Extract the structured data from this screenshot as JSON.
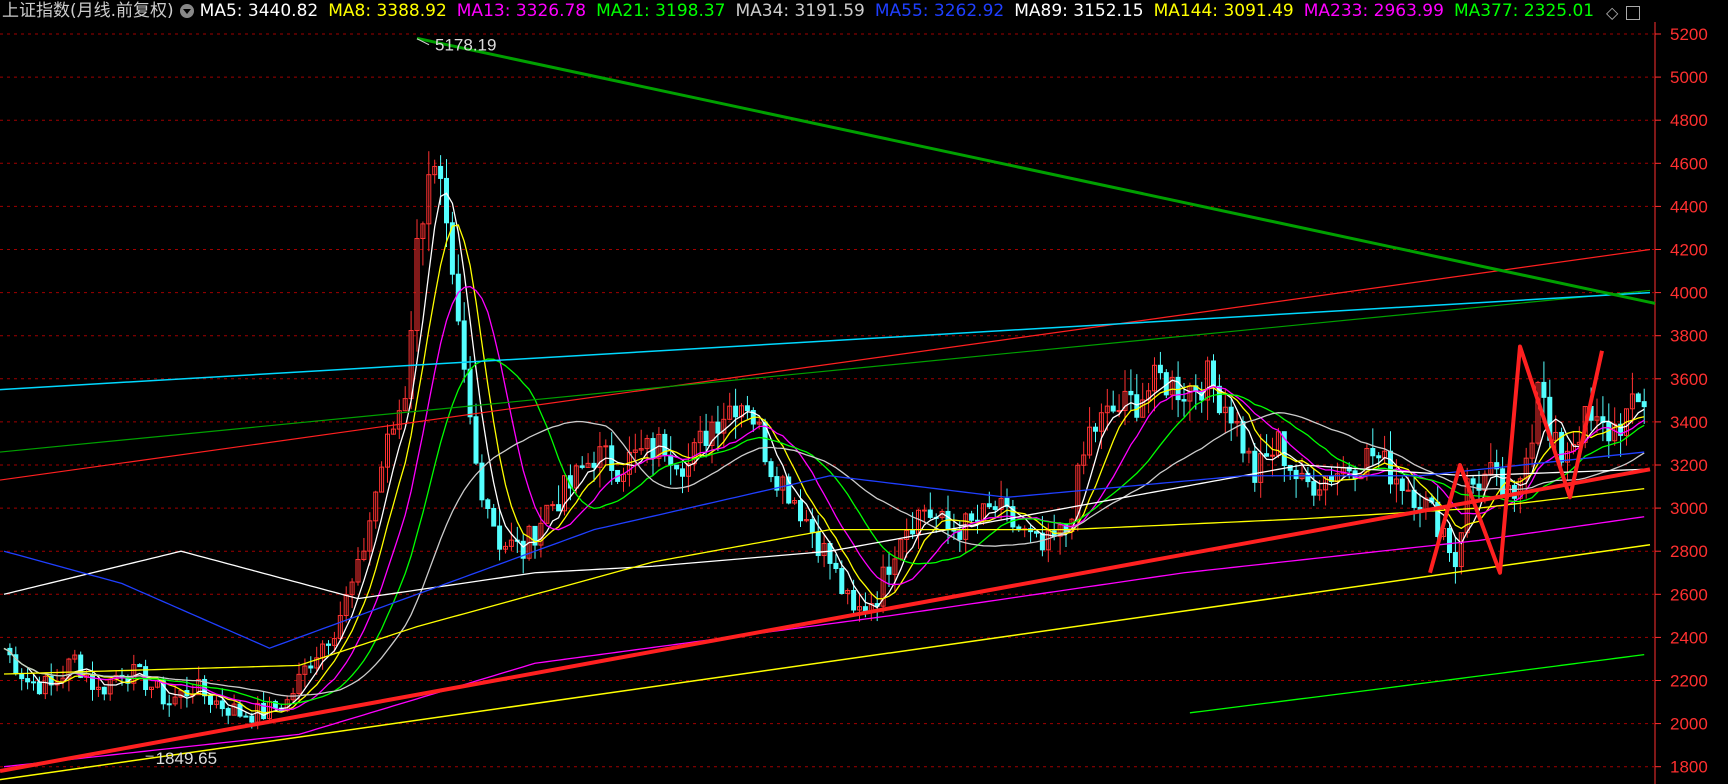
{
  "header": {
    "title": "上证指数(月线.前复权)",
    "ma": [
      {
        "label": "MA5: 3440.82",
        "color": "#ffffff"
      },
      {
        "label": "MA8: 3388.92",
        "color": "#ffff00"
      },
      {
        "label": "MA13: 3326.78",
        "color": "#ff00ff"
      },
      {
        "label": "MA21: 3198.37",
        "color": "#00ff00"
      },
      {
        "label": "MA34: 3191.59",
        "color": "#cccccc"
      },
      {
        "label": "MA55: 3262.92",
        "color": "#1f3fff"
      },
      {
        "label": "MA89: 3152.15",
        "color": "#ffffff"
      },
      {
        "label": "MA144: 3091.49",
        "color": "#ffff00"
      },
      {
        "label": "MA233: 2963.99",
        "color": "#ff00ff"
      },
      {
        "label": "MA377: 2325.01",
        "color": "#00ff00"
      }
    ]
  },
  "colors": {
    "up": "#ff3232",
    "down": "#54ffff",
    "grid": "#a00000",
    "axis": "#ff3030"
  },
  "chart_data": {
    "type": "candlestick",
    "title": "上证指数(月线.前复权)",
    "ylim": [
      1750,
      5300
    ],
    "yticks": [
      1800,
      2000,
      2200,
      2400,
      2600,
      2800,
      3000,
      3200,
      3400,
      3600,
      3800,
      4000,
      4200,
      4400,
      4600,
      4800,
      5000,
      5200
    ],
    "ytick_labels": [
      "1800",
      "2000",
      "2200",
      "2400",
      "2600",
      "2800",
      "3000",
      "3200",
      "3400",
      "3600",
      "3800",
      "4000",
      "4200",
      "4400",
      "4600",
      "4800",
      "5000",
      "5200"
    ],
    "annotations": {
      "high": "5178.19",
      "low": "1849.65"
    },
    "close_anchors": [
      [
        0,
        2350
      ],
      [
        4,
        2200
      ],
      [
        8,
        2170
      ],
      [
        12,
        2300
      ],
      [
        16,
        2150
      ],
      [
        20,
        2250
      ],
      [
        24,
        2200
      ],
      [
        28,
        2100
      ],
      [
        32,
        2170
      ],
      [
        36,
        2100
      ],
      [
        40,
        2050
      ],
      [
        44,
        2050
      ],
      [
        48,
        2100
      ],
      [
        52,
        2300
      ],
      [
        56,
        2450
      ],
      [
        60,
        2700
      ],
      [
        64,
        3200
      ],
      [
        68,
        3550
      ],
      [
        70,
        4200
      ],
      [
        72,
        4600
      ],
      [
        74,
        4450
      ],
      [
        76,
        4000
      ],
      [
        78,
        3600
      ],
      [
        80,
        3200
      ],
      [
        84,
        2850
      ],
      [
        88,
        2800
      ],
      [
        92,
        3000
      ],
      [
        96,
        3100
      ],
      [
        100,
        3250
      ],
      [
        104,
        3200
      ],
      [
        108,
        3250
      ],
      [
        112,
        3300
      ],
      [
        116,
        3200
      ],
      [
        120,
        3400
      ],
      [
        124,
        3500
      ],
      [
        126,
        3500
      ],
      [
        130,
        3200
      ],
      [
        134,
        3050
      ],
      [
        138,
        2850
      ],
      [
        140,
        2750
      ],
      [
        144,
        2500
      ],
      [
        148,
        2600
      ],
      [
        152,
        2900
      ],
      [
        156,
        3000
      ],
      [
        160,
        2900
      ],
      [
        164,
        2920
      ],
      [
        168,
        3000
      ],
      [
        172,
        2900
      ],
      [
        176,
        2800
      ],
      [
        180,
        2900
      ],
      [
        184,
        3350
      ],
      [
        188,
        3450
      ],
      [
        192,
        3500
      ],
      [
        196,
        3600
      ],
      [
        200,
        3550
      ],
      [
        204,
        3600
      ],
      [
        208,
        3450
      ],
      [
        212,
        3150
      ],
      [
        216,
        3300
      ],
      [
        220,
        3100
      ],
      [
        224,
        3150
      ],
      [
        228,
        3200
      ],
      [
        232,
        3250
      ],
      [
        236,
        3150
      ],
      [
        240,
        3050
      ],
      [
        244,
        2900
      ],
      [
        246,
        2750
      ],
      [
        248,
        3100
      ],
      [
        252,
        3150
      ],
      [
        256,
        3000
      ],
      [
        258,
        3300
      ],
      [
        259,
        3350
      ],
      [
        260,
        3650
      ],
      [
        262,
        3300
      ],
      [
        264,
        3250
      ],
      [
        268,
        3400
      ],
      [
        272,
        3350
      ],
      [
        276,
        3450
      ],
      [
        278,
        3500
      ]
    ],
    "series": [
      {
        "name": "MA89",
        "color": "#ffffff",
        "values": [
          [
            0,
            2600
          ],
          [
            30,
            2800
          ],
          [
            60,
            2580
          ],
          [
            90,
            2700
          ],
          [
            110,
            2730
          ],
          [
            140,
            2800
          ],
          [
            170,
            2950
          ],
          [
            220,
            3200
          ],
          [
            248,
            3150
          ],
          [
            278,
            3180
          ]
        ]
      },
      {
        "name": "MA55",
        "color": "#1f3fff",
        "values": [
          [
            0,
            2800
          ],
          [
            20,
            2650
          ],
          [
            45,
            2350
          ],
          [
            70,
            2600
          ],
          [
            100,
            2900
          ],
          [
            140,
            3150
          ],
          [
            170,
            3050
          ],
          [
            210,
            3150
          ],
          [
            240,
            3150
          ],
          [
            278,
            3260
          ]
        ]
      },
      {
        "name": "MA144",
        "color": "#ffff00",
        "values": [
          [
            0,
            2230
          ],
          [
            50,
            2270
          ],
          [
            70,
            2450
          ],
          [
            110,
            2750
          ],
          [
            140,
            2900
          ],
          [
            180,
            2900
          ],
          [
            220,
            2950
          ],
          [
            250,
            3000
          ],
          [
            278,
            3090
          ]
        ]
      },
      {
        "name": "MA233",
        "color": "#ff00ff",
        "values": [
          [
            0,
            1800
          ],
          [
            50,
            1950
          ],
          [
            90,
            2280
          ],
          [
            150,
            2500
          ],
          [
            200,
            2700
          ],
          [
            250,
            2850
          ],
          [
            278,
            2960
          ]
        ]
      },
      {
        "name": "MA377",
        "color": "#00ff00",
        "values": [
          [
            201,
            2050
          ],
          [
            230,
            2150
          ],
          [
            278,
            2320
          ]
        ]
      }
    ]
  }
}
